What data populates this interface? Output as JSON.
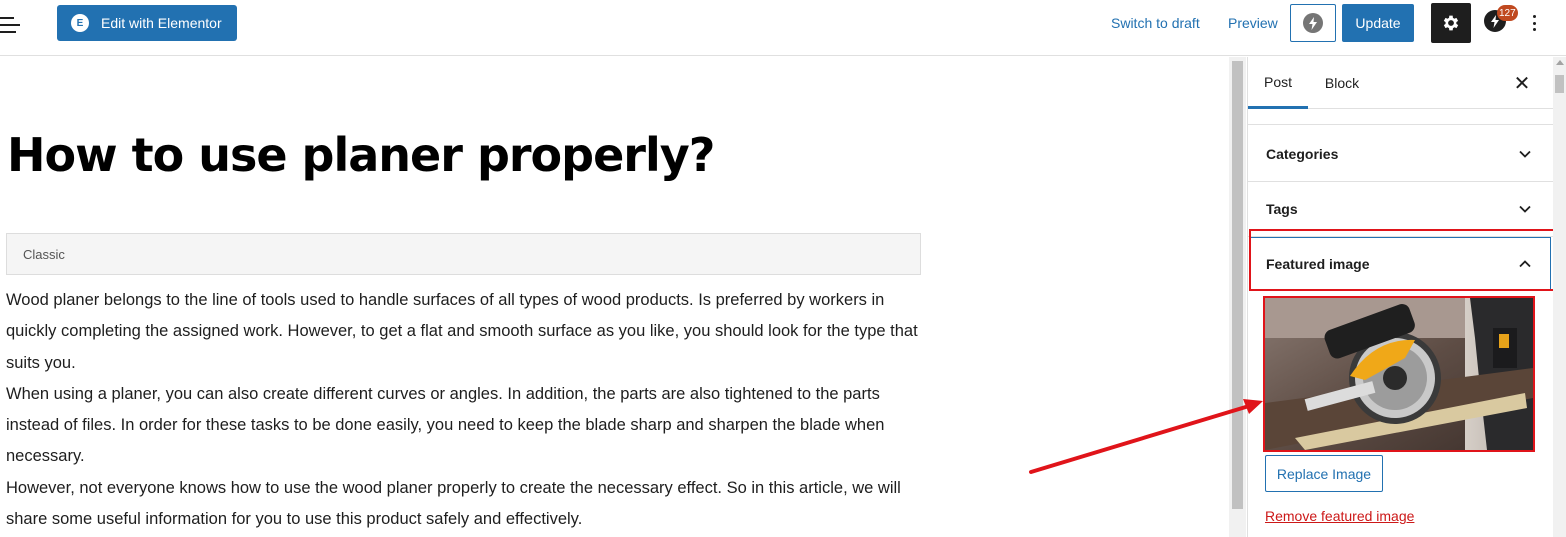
{
  "toolbar": {
    "elementor_label": "Edit with Elementor",
    "elementor_logo": "E",
    "switch_to_draft": "Switch to draft",
    "preview": "Preview",
    "update": "Update",
    "notification_count": "127",
    "icons": [
      "menu-icon",
      "elementor-icon",
      "lightning-icon",
      "gear-icon",
      "bolt-icon",
      "kebab-menu-icon"
    ]
  },
  "editor": {
    "title": "How to use planer properly?",
    "block_label": "Classic",
    "paragraphs": [
      "Wood planer belongs to the line of tools used to handle surfaces of all types of wood products. Is preferred by workers in quickly completing the assigned work. However, to get a flat and smooth surface as you like, you should look for the type that suits you.",
      "When using a planer, you can also create different curves or angles. In addition, the parts are also tightened to the parts instead of files. In order for these tasks to be done easily, you need to keep the blade sharp and sharpen the blade when necessary.",
      "However, not everyone knows how to use the wood planer properly to create the necessary effect. So in this article, we will share some useful information for you to use this product safely and effectively."
    ]
  },
  "sidebar": {
    "tabs": [
      {
        "label": "Post",
        "active": true
      },
      {
        "label": "Block",
        "active": false
      }
    ],
    "panels": [
      {
        "label": "Categories",
        "expanded": false
      },
      {
        "label": "Tags",
        "expanded": false
      },
      {
        "label": "Featured image",
        "expanded": true
      }
    ],
    "replace_image": "Replace Image",
    "remove_featured_image": "Remove featured image"
  },
  "colors": {
    "accent": "#2271b1",
    "highlight_annotation": "#e0141a",
    "destructive_link": "#cc1818",
    "badge": "#c0491f"
  }
}
